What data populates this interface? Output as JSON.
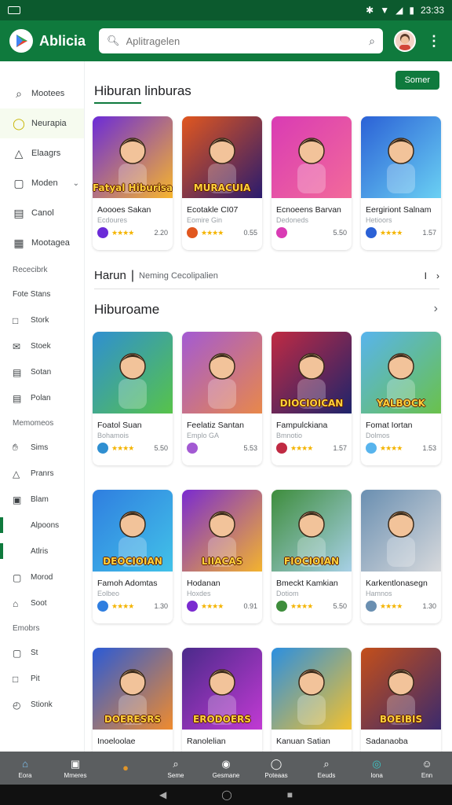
{
  "status_bar": {
    "left": "",
    "time": "23:33"
  },
  "app_bar": {
    "title": "Ablicia",
    "search_placeholder": "Aplitragelen"
  },
  "sidebar": {
    "items": [
      {
        "label": "Mootees",
        "icon": "search-icon"
      },
      {
        "label": "Neurapia",
        "icon": "chat-icon"
      },
      {
        "label": "Elaagrs",
        "icon": "warning-icon"
      },
      {
        "label": "Moden",
        "icon": "tag-icon"
      },
      {
        "label": "Canol",
        "icon": "calendar-icon"
      },
      {
        "label": "Mootagea",
        "icon": "news-icon"
      }
    ],
    "header1": "Rececibrk",
    "group1": [
      {
        "label": "Fote Stans",
        "icon": "none"
      },
      {
        "label": "Stork",
        "icon": "book-icon"
      },
      {
        "label": "Stoek",
        "icon": "mail-icon"
      },
      {
        "label": "Sotan",
        "icon": "calendar-icon"
      },
      {
        "label": "Polan",
        "icon": "calendar-icon"
      }
    ],
    "header2": "Memomeos",
    "group2": [
      {
        "label": "Sims",
        "icon": "hand-icon"
      },
      {
        "label": "Pranrs",
        "icon": "warning-icon"
      },
      {
        "label": "Blam",
        "icon": "book-icon"
      },
      {
        "label": "Alpoons",
        "icon": "none"
      },
      {
        "label": "Atlris",
        "icon": "none"
      },
      {
        "label": "Morod",
        "icon": "mail-icon"
      },
      {
        "label": "Soot",
        "icon": "gift-icon"
      }
    ],
    "header3": "Emobrs",
    "group3": [
      {
        "label": "St",
        "icon": "mail-icon"
      },
      {
        "label": "Pit",
        "icon": "chat-icon"
      },
      {
        "label": "Stionk",
        "icon": "clock-icon"
      }
    ]
  },
  "section1": {
    "title": "Hiburan linburas",
    "action": "Somer",
    "cards": [
      {
        "name": "Aoooes Sakan",
        "dev": "Ecdoures",
        "rating": "2.20",
        "stars": 4,
        "thumb": "Fatyal Hiburisa",
        "colors": [
          "#6b2bd8",
          "#f7b52c"
        ]
      },
      {
        "name": "Ecotakle CI07",
        "dev": "Eomire Gin",
        "rating": "0.55",
        "stars": 4,
        "thumb": "MURACUIA",
        "colors": [
          "#e1571f",
          "#2a1b6e"
        ]
      },
      {
        "name": "Ecnoeens Barvan",
        "dev": "Dedoneds",
        "rating": "5.50",
        "stars": 0,
        "thumb": "",
        "colors": [
          "#d93bb4",
          "#f26a9a"
        ]
      },
      {
        "name": "Eergiriont Salnam",
        "dev": "Hetioors",
        "rating": "1.57",
        "stars": 4,
        "thumb": "",
        "colors": [
          "#2b61d6",
          "#6ad0f3"
        ]
      }
    ]
  },
  "sub_row": {
    "bold": "Harun",
    "muted": "Neming Cecolipalien",
    "end": "I"
  },
  "section2": {
    "title": "Hiburoame",
    "cards": [
      {
        "name": "Foatol Suan",
        "dev": "Bohamois",
        "rating": "5.50",
        "stars": 4,
        "thumb": "",
        "colors": [
          "#2f8fd1",
          "#57c34a"
        ]
      },
      {
        "name": "Feelatiz Santan",
        "dev": "Emplo GA",
        "rating": "5.53",
        "stars": 0,
        "thumb": "",
        "colors": [
          "#a35ad3",
          "#e8884a"
        ]
      },
      {
        "name": "Fampulckiana",
        "dev": "Bmnotio",
        "rating": "1.57",
        "stars": 4,
        "thumb": "DIOCIOICAN",
        "colors": [
          "#c02a43",
          "#1e246b"
        ]
      },
      {
        "name": "Fomat Iortan",
        "dev": "Dolmos",
        "rating": "1.53",
        "stars": 4,
        "thumb": "YALBOCK",
        "colors": [
          "#58b4ed",
          "#6ac14b"
        ]
      }
    ]
  },
  "section3": {
    "cards": [
      {
        "name": "Famoh Adomtas",
        "dev": "Eolbeo",
        "rating": "1.30",
        "stars": 4,
        "thumb": "DEOCIOIAN",
        "colors": [
          "#2f7ee0",
          "#42c2e8"
        ]
      },
      {
        "name": "Hodanan",
        "dev": "Hoxdes",
        "rating": "0.91",
        "stars": 4,
        "thumb": "LIIACAS",
        "colors": [
          "#7a2bd0",
          "#f3b32e"
        ]
      },
      {
        "name": "Bmeckt Kamkian",
        "dev": "Dotiom",
        "rating": "5.50",
        "stars": 4,
        "thumb": "FIOCIOIAN",
        "colors": [
          "#3e8d3c",
          "#a7d0e6"
        ]
      },
      {
        "name": "Karkentlonasegn",
        "dev": "Hamnos",
        "rating": "1.30",
        "stars": 4,
        "thumb": "",
        "colors": [
          "#6a8fb1",
          "#d7d9dc"
        ]
      }
    ]
  },
  "section4": {
    "cards": [
      {
        "name": "Inoeloolae",
        "dev": "",
        "thumb": "DOERESRS",
        "colors": [
          "#2a5ad6",
          "#ef8b2e"
        ]
      },
      {
        "name": "Ranolelian",
        "dev": "",
        "thumb": "ERODOERS",
        "colors": [
          "#4a2a8a",
          "#c13ad3"
        ]
      },
      {
        "name": "Kanuan Satian",
        "dev": "",
        "thumb": "",
        "colors": [
          "#2b8fe0",
          "#f3c12e"
        ]
      },
      {
        "name": "Sadanaoba",
        "dev": "",
        "thumb": "BOEIBIS",
        "colors": [
          "#c44f1a",
          "#3b2a6d"
        ]
      }
    ]
  },
  "bottom_nav": [
    {
      "label": "Eora",
      "icon": "home-icon"
    },
    {
      "label": "Mmeres",
      "icon": "apps-icon"
    },
    {
      "label": "",
      "icon": "circle-icon"
    },
    {
      "label": "Seme",
      "icon": "search-icon"
    },
    {
      "label": "Gesmane",
      "icon": "camera-icon"
    },
    {
      "label": "Poteaas",
      "icon": "ring-icon"
    },
    {
      "label": "Eeuds",
      "icon": "search-icon"
    },
    {
      "label": "Iona",
      "icon": "teal-icon"
    },
    {
      "label": "Enn",
      "icon": "user-icon"
    }
  ]
}
